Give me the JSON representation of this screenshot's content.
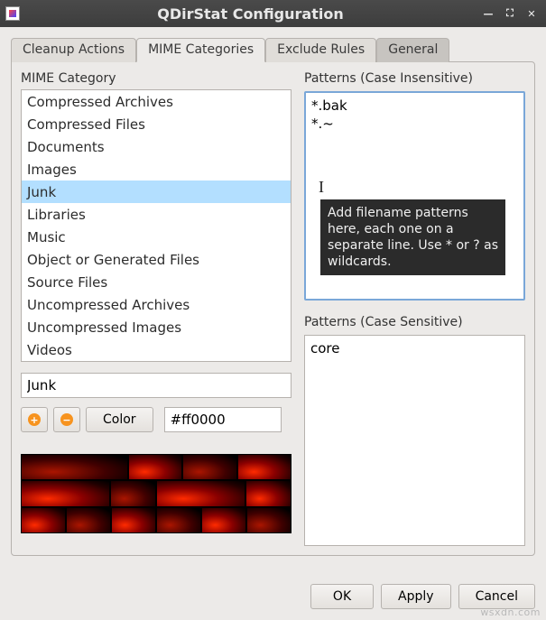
{
  "window": {
    "title": "QDirStat Configuration"
  },
  "tabs": [
    {
      "label": "Cleanup Actions"
    },
    {
      "label": "MIME Categories"
    },
    {
      "label": "Exclude Rules"
    },
    {
      "label": "General"
    }
  ],
  "active_tab": 1,
  "left": {
    "heading": "MIME Category",
    "items": [
      "Compressed Archives",
      "Compressed Files",
      "Documents",
      "Images",
      "Junk",
      "Libraries",
      "Music",
      "Object or Generated Files",
      "Source Files",
      "Uncompressed Archives",
      "Uncompressed Images",
      "Videos"
    ],
    "selected_index": 4,
    "name_value": "Junk",
    "color_button": "Color",
    "color_value": "#ff0000"
  },
  "right": {
    "ci_label": "Patterns (Case Insensitive)",
    "ci_value": "*.bak\n*.~\n",
    "cs_label": "Patterns (Case Sensitive)",
    "cs_value": "core",
    "tooltip": "Add filename patterns here, each one on a separate line. Use * or ? as wildcards."
  },
  "buttons": {
    "ok": "OK",
    "apply": "Apply",
    "cancel": "Cancel"
  },
  "watermark": "wsxdn.com"
}
